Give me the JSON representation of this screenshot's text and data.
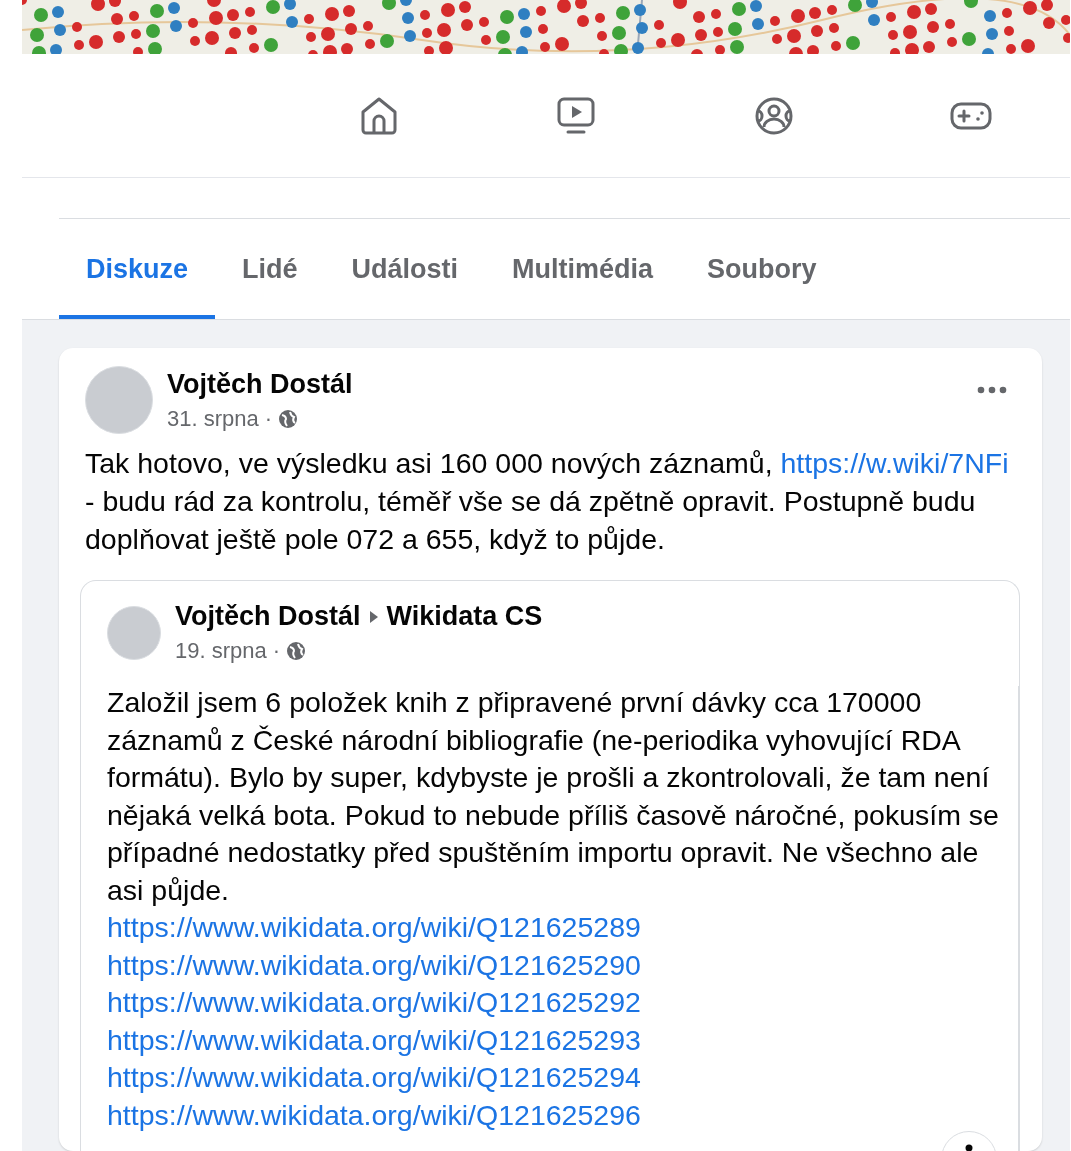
{
  "nav": {
    "items": [
      {
        "kind": "home",
        "selected": false
      },
      {
        "kind": "video",
        "selected": false
      },
      {
        "kind": "groups",
        "selected": false
      },
      {
        "kind": "gaming",
        "selected": false
      }
    ]
  },
  "tabs": [
    {
      "label": "Diskuze",
      "selected": true
    },
    {
      "label": "Lidé",
      "selected": false
    },
    {
      "label": "Události",
      "selected": false
    },
    {
      "label": "Multimédia",
      "selected": false
    },
    {
      "label": "Soubory",
      "selected": false
    }
  ],
  "post": {
    "author": "Vojtěch Dostál",
    "date": "31. srpna",
    "separator": "·",
    "text": [
      {
        "kind": "text",
        "value": "Tak hotovo, ve výsledku asi 160 000 nových záznamů, "
      },
      {
        "kind": "link",
        "value": "https://w.wiki/7NFi"
      },
      {
        "kind": "text",
        "value": " - budu rád za kontrolu, téměř vše se dá zpětně opravit. Postupně budu doplňovat ještě pole 072 a 655, když to půjde."
      }
    ],
    "shared": {
      "author": "Vojtěch Dostál",
      "group": "Wikidata CS",
      "date": "19. srpna",
      "separator": "·",
      "text": "Založil jsem 6 položek knih z připravené první dávky cca 170000 záznamů z České národní bibliografie (ne-periodika vyhovující RDA formátu). Bylo by super, kdybyste je prošli a zkontrolovali, že tam není nějaká velká bota. Pokud to nebude příliš časově náročné, pokusím se případné nedostatky před spuštěním importu opravit. Ne všechno ale asi půjde.",
      "links": [
        "https://www.wikidata.org/wiki/Q121625289",
        "https://www.wikidata.org/wiki/Q121625290",
        "https://www.wikidata.org/wiki/Q121625292",
        "https://www.wikidata.org/wiki/Q121625293",
        "https://www.wikidata.org/wiki/Q121625294",
        "https://www.wikidata.org/wiki/Q121625296"
      ]
    }
  }
}
